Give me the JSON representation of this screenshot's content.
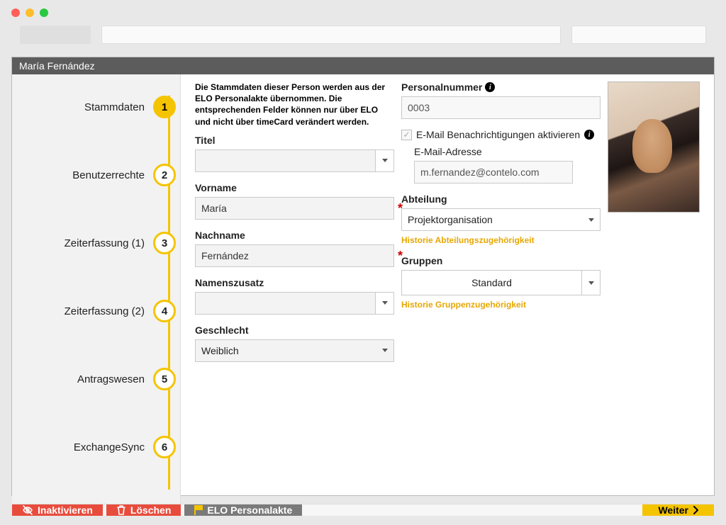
{
  "header": {
    "person_name": "María Fernández"
  },
  "steps": [
    {
      "n": "1",
      "label": "Stammdaten",
      "active": true
    },
    {
      "n": "2",
      "label": "Benutzerrechte",
      "active": false
    },
    {
      "n": "3",
      "label": "Zeiterfassung (1)",
      "active": false
    },
    {
      "n": "4",
      "label": "Zeiterfassung (2)",
      "active": false
    },
    {
      "n": "5",
      "label": "Antragswesen",
      "active": false
    },
    {
      "n": "6",
      "label": "ExchangeSync",
      "active": false
    }
  ],
  "intro": "Die Stammdaten dieser Person werden aus der ELO Personalakte übernommen. Die entsprechenden Felder können nur über ELO und nicht über timeCard verändert werden.",
  "leftForm": {
    "titel_label": "Titel",
    "titel_value": "",
    "vorname_label": "Vorname",
    "vorname_value": "María",
    "nachname_label": "Nachname",
    "nachname_value": "Fernández",
    "namenszusatz_label": "Namenszusatz",
    "namenszusatz_value": "",
    "geschlecht_label": "Geschlecht",
    "geschlecht_value": "Weiblich"
  },
  "rightForm": {
    "personalnummer_label": "Personalnummer",
    "personalnummer_value": "0003",
    "email_notify_label": "E-Mail Benachrichtigungen aktivieren",
    "email_label": "E-Mail-Adresse",
    "email_value": "m.fernandez@contelo.com",
    "abteilung_label": "Abteilung",
    "abteilung_value": "Projektorganisation",
    "abteilung_history": "Historie Abteilungszugehörigkeit",
    "gruppen_label": "Gruppen",
    "gruppen_value": "Standard",
    "gruppen_history": "Historie Gruppenzugehörigkeit"
  },
  "footer": {
    "inaktivieren": "Inaktivieren",
    "loeschen": "Löschen",
    "elo": "ELO Personalakte",
    "weiter": "Weiter"
  }
}
